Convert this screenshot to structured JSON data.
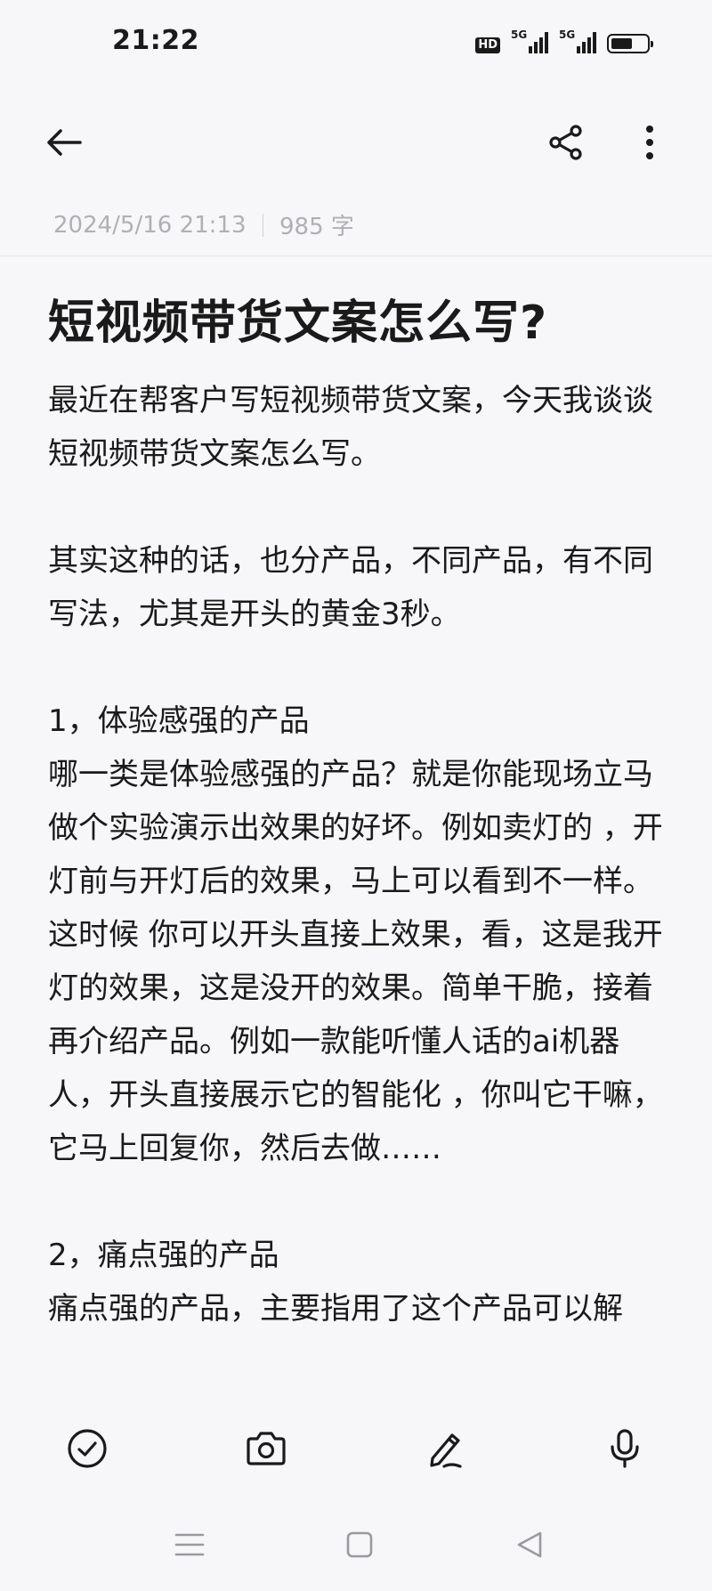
{
  "status_bar": {
    "time": "21:22",
    "hd_label": "HD",
    "signal1_label": "5G",
    "signal2_label": "5G",
    "battery_level": 0.6
  },
  "app_bar": {
    "back_icon": "arrow-left-icon",
    "share_icon": "share-icon",
    "more_icon": "more-vertical-icon"
  },
  "meta": {
    "datetime": "2024/5/16 21:13",
    "word_count": "985 字"
  },
  "note": {
    "title": "短视频带货文案怎么写?",
    "paragraphs": [
      "最近在帮客户写短视频带货文案，今天我谈谈短视频带货文案怎么写。",
      "",
      "其实这种的话，也分产品，不同产品，有不同写法，尤其是开头的黄金3秒。",
      "",
      "1，体验感强的产品",
      "哪一类是体验感强的产品？就是你能现场立马做个实验演示出效果的好坏。例如卖灯的 ，开灯前与开灯后的效果，马上可以看到不一样。这时候 你可以开头直接上效果，看，这是我开灯的效果，这是没开的效果。简单干脆，接着再介绍产品。例如一款能听懂人话的ai机器人，开头直接展示它的智能化 ，你叫它干嘛，它马上回复你，然后去做……",
      "",
      "2，痛点强的产品",
      "痛点强的产品，主要指用了这个产品可以解"
    ]
  },
  "toolbar": {
    "checklist_icon": "check-circle-icon",
    "camera_icon": "camera-icon",
    "handwrite_icon": "pen-icon",
    "voice_icon": "microphone-icon"
  },
  "navbar": {
    "menu_icon": "menu-icon",
    "home_icon": "home-square-icon",
    "back_icon": "back-triangle-icon"
  }
}
